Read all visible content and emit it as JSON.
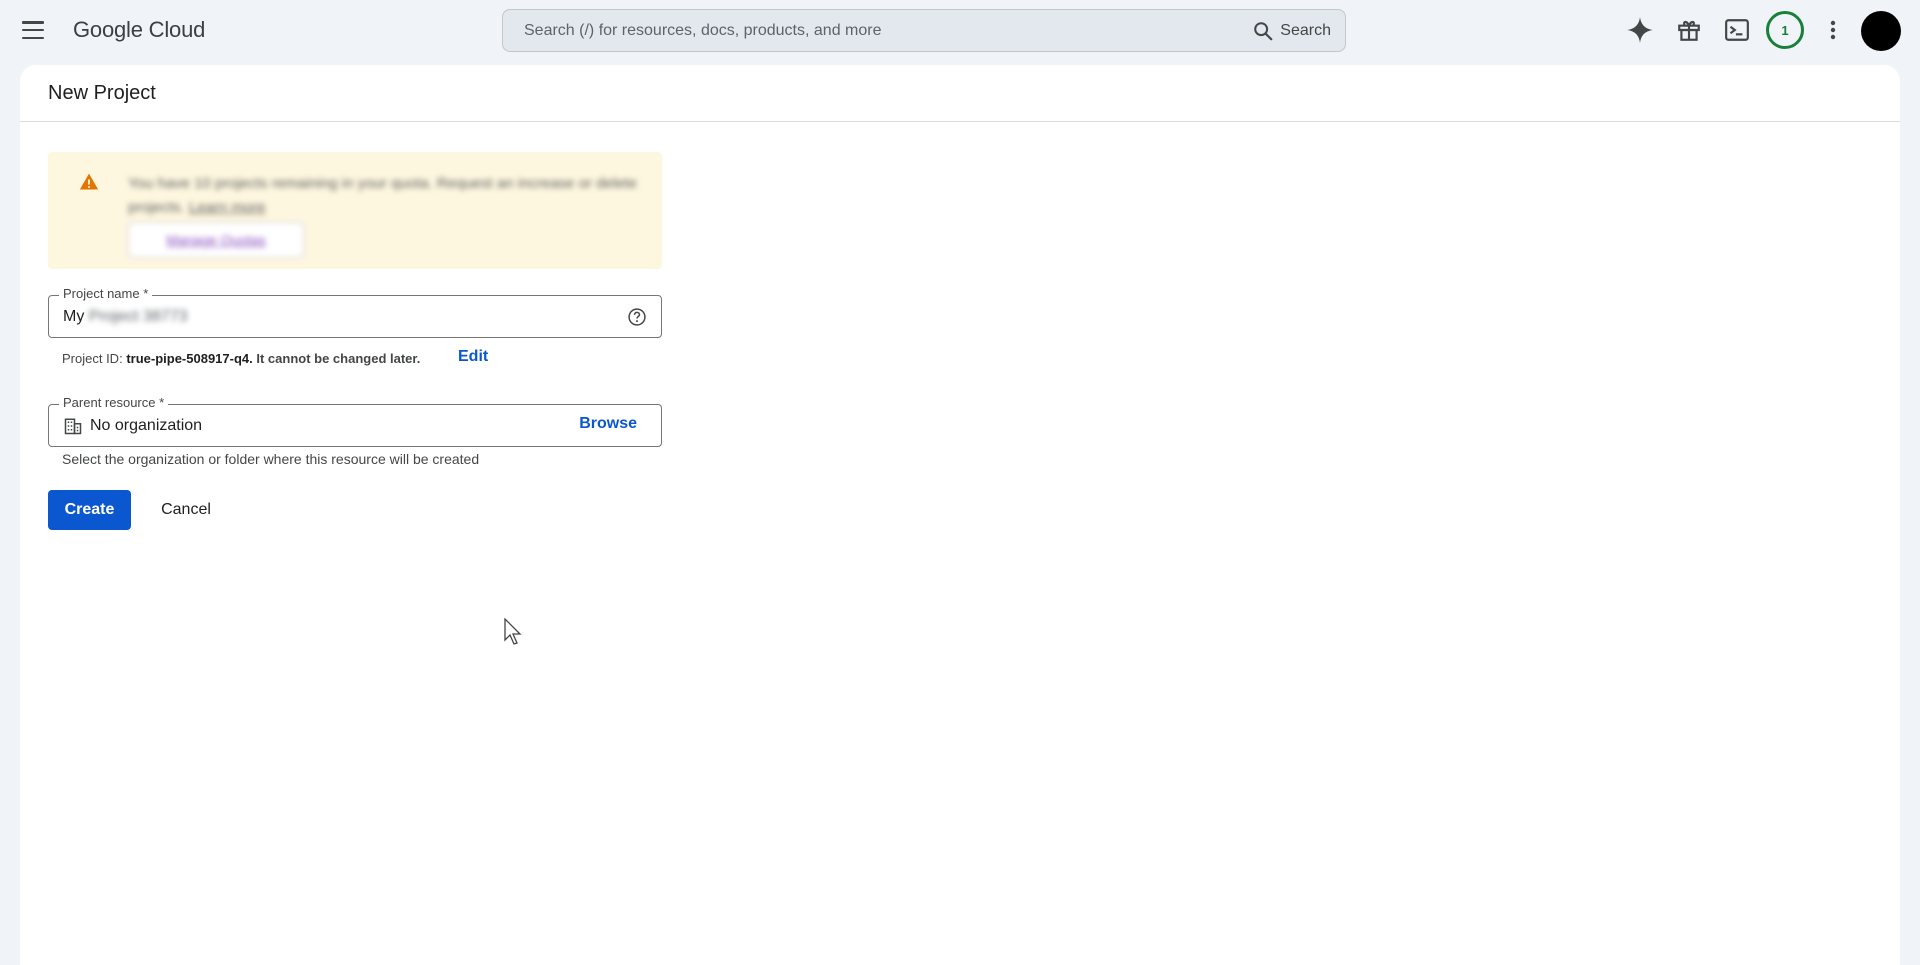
{
  "header": {
    "brand": "Google Cloud",
    "search_placeholder": "Search (/) for resources, docs, products, and more",
    "search_button": "Search",
    "notification_count": "1",
    "icons": [
      "menu-icon",
      "gemini-sparkle-icon",
      "gift-icon",
      "cloud-shell-terminal-icon",
      "more-vert-icon"
    ]
  },
  "page": {
    "title": "New Project"
  },
  "quota_notice": {
    "text_prefix": "You have 10 projects remaining in your quota. Request an increase or delete projects.",
    "learn_more": "Learn more",
    "manage_button": "Manage Quotas"
  },
  "project_name": {
    "label": "Project name *",
    "value_visible": "My",
    "value_blurred": "Project 38773"
  },
  "project_id": {
    "prefix": "Project ID:",
    "id": "true-pipe-508917-q4.",
    "suffix": "It cannot be changed later.",
    "edit_label": "Edit"
  },
  "parent_resource": {
    "label": "Parent resource *",
    "value": "No organization",
    "browse_label": "Browse",
    "help_text": "Select the organization or folder where this resource will be created"
  },
  "actions": {
    "create_label": "Create",
    "cancel_label": "Cancel"
  },
  "colors": {
    "primary": "#0b57d0",
    "background": "#f0f4f9",
    "warning_bg": "#fef7e0",
    "warning_icon": "#e37400",
    "badge": "#188038"
  }
}
